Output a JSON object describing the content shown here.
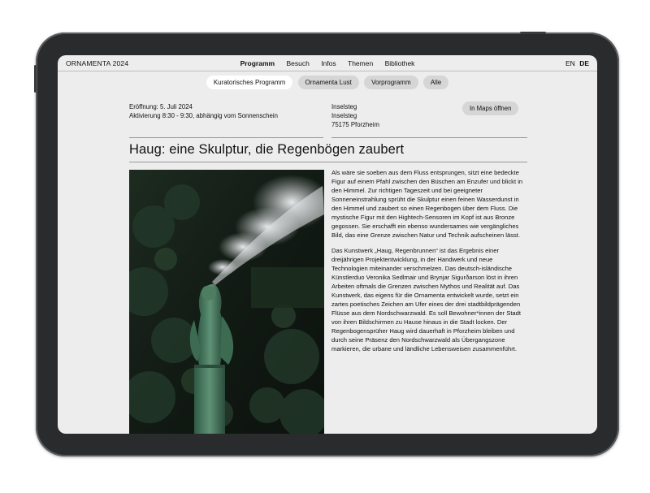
{
  "header": {
    "brand": "ORNAMENTA 2024",
    "nav": [
      "Programm",
      "Besuch",
      "Infos",
      "Themen",
      "Bibliothek"
    ],
    "active_nav": "Programm",
    "languages": [
      "EN",
      "DE"
    ],
    "active_language": "DE"
  },
  "filters": {
    "items": [
      "Kuratorisches Programm",
      "Ornamenta Lust",
      "Vorprogramm",
      "Alle"
    ],
    "active": "Kuratorisches Programm"
  },
  "event": {
    "opening": "Eröffnung: 5. Juli 2024",
    "activation": "Aktivierung 8:30 - 9:30, abhängig vom Sonnenschein",
    "location_lines": [
      "Inselsteg",
      "Inselsteg",
      "75175 Pforzheim"
    ],
    "maps_button": "In Maps öffnen"
  },
  "article": {
    "title": "Haug: eine Skulptur, die Regenbögen zaubert",
    "image_alt": "Grüne Bronzefigur auf einem Pfahl, die einen Wassernebel versprüht",
    "paragraphs": [
      "Als wäre sie soeben aus dem Fluss entsprungen, sitzt eine bedeckte Figur auf einem Pfahl zwischen den Büschen am Enzufer und blickt in den Himmel. Zur richtigen Tageszeit und bei geeigneter Sonneneinstrahlung sprüht die Skulptur einen feinen Wasserdunst in den Himmel und zaubert so einen Regenbogen über dem Fluss. Die mystische Figur mit den Hightech-Sensoren im Kopf ist aus Bronze gegossen. Sie erschafft ein ebenso wundersames wie vergängliches Bild, das eine Grenze zwischen Natur und Technik aufscheinen lässt.",
      "Das Kunstwerk „Haug, Regenbrunnen“ ist das Ergebnis einer dreijährigen Projektentwicklung, in der Handwerk und neue Technologien miteinander verschmelzen. Das deutsch-isländische Künstlerduo Veronika Sedlmair und Brynjar Sigurðarson löst in ihren Arbeiten oftmals die Grenzen zwischen Mythos und Realität auf. Das Kunstwerk, das eigens für die Ornamenta entwickelt wurde, setzt ein zartes poetisches Zeichen am Ufer eines der drei stadtbildprägenden Flüsse aus dem Nordschwarzwald. Es soll Bewohner*innen der Stadt von ihren Bildschirmen zu Hause hinaus in die Stadt locken. Der Regenbogensprüher Haug wird dauerhaft in Pforzheim bleiben und durch seine Präsenz den Nordschwarzwald als Übergangszone markieren, die urbane und ländliche Lebensweisen zusammenführt."
    ]
  },
  "colors": {
    "screen_bg": "#ededed",
    "pill_bg": "#d6d6d6",
    "pill_active_bg": "#ffffff",
    "device_frame": "#2a2b2d",
    "bronze_green": "#4e7e62",
    "mist": "#d9dcdf"
  }
}
